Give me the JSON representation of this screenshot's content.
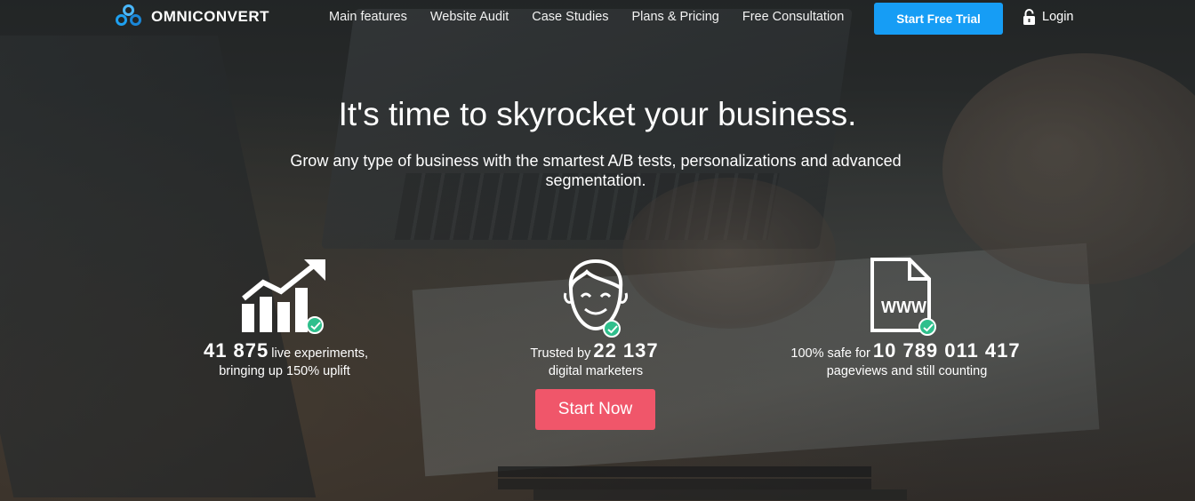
{
  "brand": {
    "name": "OMNICONVERT"
  },
  "nav": {
    "items": [
      "Main features",
      "Website Audit",
      "Case Studies",
      "Plans & Pricing",
      "Free Consultation"
    ],
    "cta": "Start Free Trial",
    "login": "Login"
  },
  "hero": {
    "headline": "It's time to skyrocket your business.",
    "subheadline": "Grow any type of business with the smartest A/B tests, personalizations and advanced segmentation."
  },
  "stats": [
    {
      "icon": "growth-chart-icon",
      "number": "41 875",
      "prefix": "",
      "suffix": "live experiments,",
      "line2": "bringing up 150% uplift"
    },
    {
      "icon": "smiling-face-icon",
      "number": "22 137",
      "prefix": "Trusted by",
      "suffix": "",
      "line2": "digital marketers"
    },
    {
      "icon": "www-document-icon",
      "number": "10 789 011 417",
      "prefix": "100% safe for",
      "suffix": "",
      "line2": "pageviews and still counting"
    }
  ],
  "start_button": "Start Now",
  "colors": {
    "primary": "#169df5",
    "accent": "#f0566a",
    "check": "#2fbf8c"
  }
}
